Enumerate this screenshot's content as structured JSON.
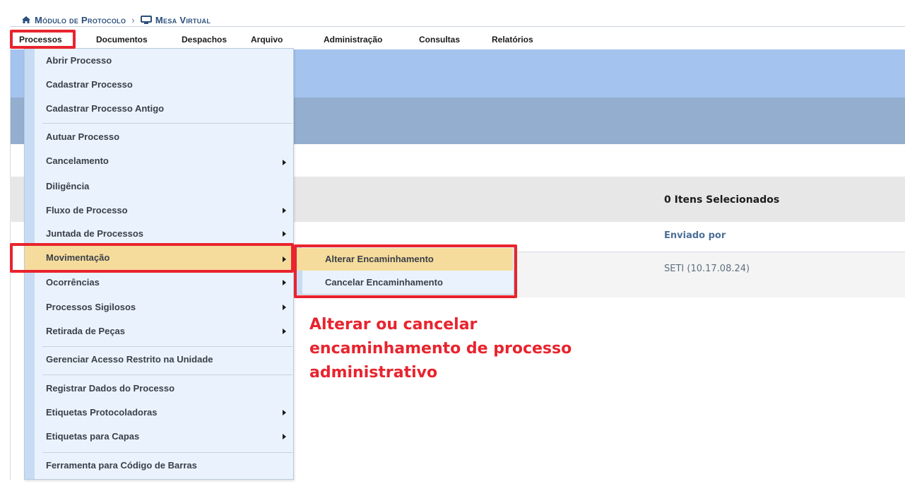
{
  "breadcrumb": {
    "home_icon": "home-icon",
    "module": "Módulo de Protocolo",
    "separator": "›",
    "desk_icon": "monitor-icon",
    "current": "Mesa Virtual"
  },
  "menubar": {
    "items": [
      "Processos",
      "Documentos",
      "Despachos",
      "Arquivo",
      "Administração",
      "Consultas",
      "Relatórios"
    ],
    "active_index": 0
  },
  "dropdown": {
    "items": [
      {
        "label": "Abrir Processo",
        "submenu": false
      },
      {
        "label": "Cadastrar Processo",
        "submenu": false
      },
      {
        "label": "Cadastrar Processo Antigo",
        "submenu": false
      },
      {
        "label": "Autuar Processo",
        "submenu": false
      },
      {
        "label": "Cancelamento",
        "submenu": true
      },
      {
        "label": "Diligência",
        "submenu": false
      },
      {
        "label": "Fluxo de Processo",
        "submenu": true
      },
      {
        "label": "Juntada de Processos",
        "submenu": true
      },
      {
        "label": "Movimentação",
        "submenu": true,
        "highlighted": true
      },
      {
        "label": "Ocorrências",
        "submenu": true
      },
      {
        "label": "Processos Sigilosos",
        "submenu": true
      },
      {
        "label": "Retirada de Peças",
        "submenu": true
      },
      {
        "label": "Gerenciar Acesso Restrito na Unidade",
        "submenu": false
      },
      {
        "label": "Registrar Dados do Processo",
        "submenu": false
      },
      {
        "label": "Etiquetas Protocoladoras",
        "submenu": true
      },
      {
        "label": "Etiquetas para Capas",
        "submenu": true
      },
      {
        "label": "Ferramenta para Código de Barras",
        "submenu": false
      }
    ]
  },
  "submenu": {
    "items": [
      "Alterar Encaminhamento",
      "Cancelar Encaminhamento"
    ]
  },
  "table": {
    "selected_count": "0 Itens Selecionados",
    "column_sent_by": "Enviado por",
    "row_sent_by": "SETI (10.17.08.24)"
  },
  "annotation": {
    "text": "Alterar ou cancelar encaminhamento de processo administrativo",
    "color": "#e8242e"
  },
  "colors": {
    "menu_bg": "#eaf3fd",
    "highlight": "#f5dc9c",
    "band_top": "#a4c3ee",
    "band_bottom": "#93aece"
  }
}
